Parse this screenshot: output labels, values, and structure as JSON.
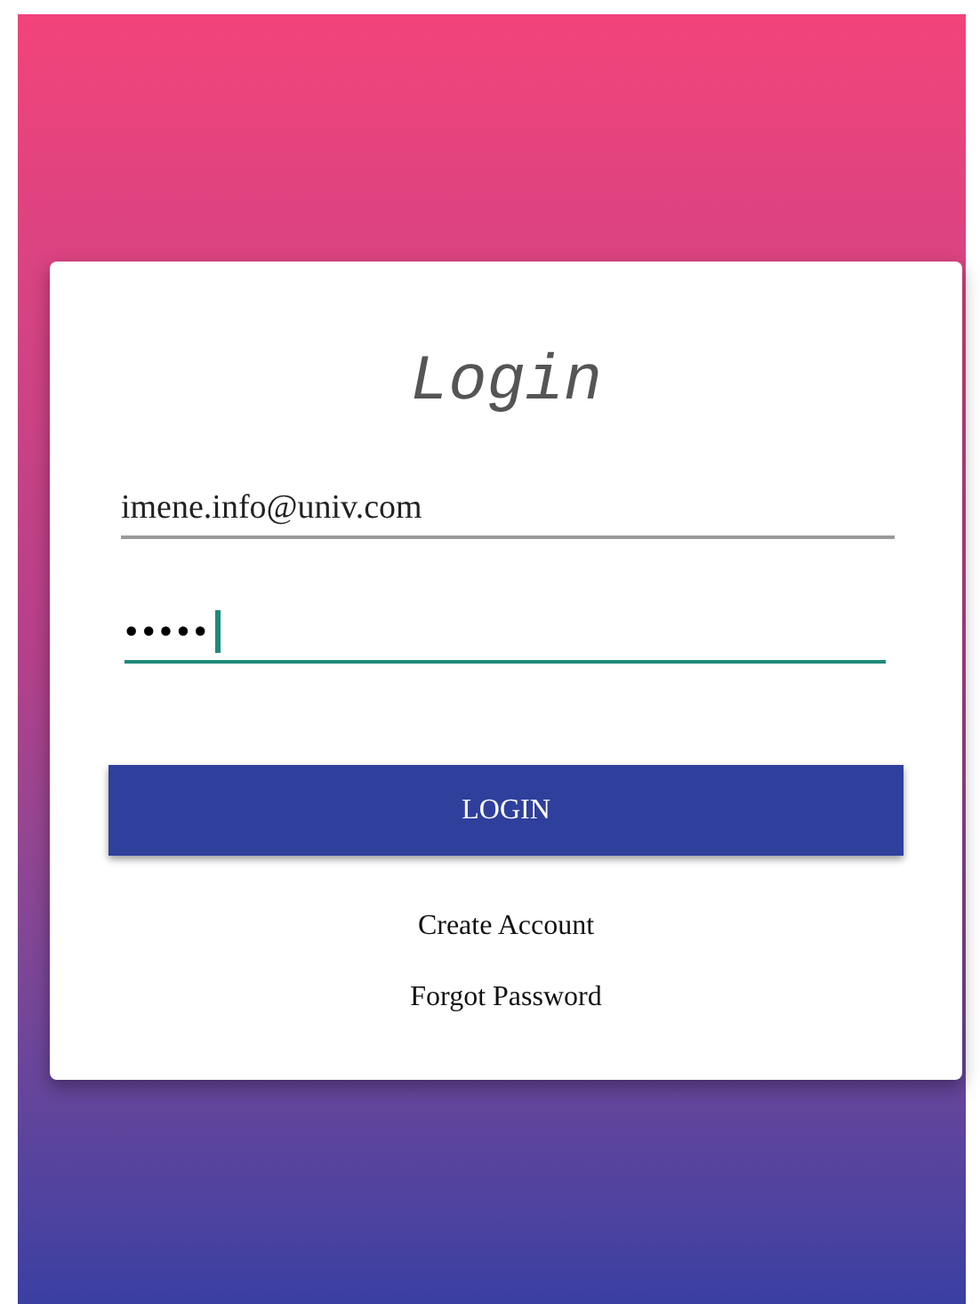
{
  "title": "Login",
  "email": {
    "value": "imene.info@univ.com",
    "focused": false
  },
  "password": {
    "value": "•••••",
    "focused": true
  },
  "login_button": "LOGIN",
  "links": [
    "Create Account",
    "Forgot Password"
  ]
}
